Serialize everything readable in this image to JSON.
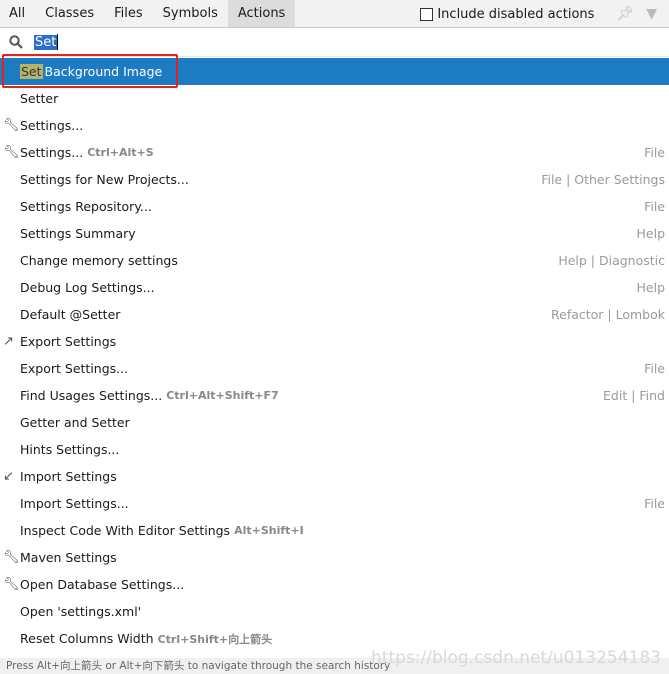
{
  "tabs": [
    "All",
    "Classes",
    "Files",
    "Symbols",
    "Actions"
  ],
  "active_tab": "Actions",
  "include_disabled_label": "Include disabled actions",
  "include_disabled_checked": false,
  "search": {
    "value": "Set"
  },
  "selected": {
    "highlight": "Set",
    "rest": "Background Image"
  },
  "items": [
    {
      "label": "Setter",
      "shortcut": "",
      "group": "",
      "icon": ""
    },
    {
      "label": "Settings...",
      "shortcut": "",
      "group": "",
      "icon": "wrench-icon"
    },
    {
      "label": "Settings...",
      "shortcut": "Ctrl+Alt+S",
      "group": "File",
      "icon": "wrench-icon"
    },
    {
      "label": "Settings for New Projects...",
      "shortcut": "",
      "group": "File | Other Settings",
      "icon": ""
    },
    {
      "label": "Settings Repository...",
      "shortcut": "",
      "group": "File",
      "icon": ""
    },
    {
      "label": "Settings Summary",
      "shortcut": "",
      "group": "Help",
      "icon": ""
    },
    {
      "label": "Change memory settings",
      "shortcut": "",
      "group": "Help | Diagnostic",
      "icon": ""
    },
    {
      "label": "Debug Log Settings...",
      "shortcut": "",
      "group": "Help",
      "icon": ""
    },
    {
      "label": "Default @Setter",
      "shortcut": "",
      "group": "Refactor | Lombok",
      "icon": ""
    },
    {
      "label": "Export Settings",
      "shortcut": "",
      "group": "",
      "icon": "export-icon"
    },
    {
      "label": "Export Settings...",
      "shortcut": "",
      "group": "File",
      "icon": ""
    },
    {
      "label": "Find Usages Settings...",
      "shortcut": "Ctrl+Alt+Shift+F7",
      "group": "Edit | Find",
      "icon": ""
    },
    {
      "label": "Getter and Setter",
      "shortcut": "",
      "group": "",
      "icon": ""
    },
    {
      "label": "Hints Settings...",
      "shortcut": "",
      "group": "",
      "icon": ""
    },
    {
      "label": "Import Settings",
      "shortcut": "",
      "group": "",
      "icon": "import-icon"
    },
    {
      "label": "Import Settings...",
      "shortcut": "",
      "group": "File",
      "icon": ""
    },
    {
      "label": "Inspect Code With Editor Settings",
      "shortcut": "Alt+Shift+I",
      "group": "",
      "icon": ""
    },
    {
      "label": "Maven Settings",
      "shortcut": "",
      "group": "",
      "icon": "wrench-icon"
    },
    {
      "label": "Open Database Settings...",
      "shortcut": "",
      "group": "",
      "icon": "wrench-icon"
    },
    {
      "label": "Open 'settings.xml'",
      "shortcut": "",
      "group": "",
      "icon": ""
    },
    {
      "label": "Reset Columns Width",
      "shortcut": "Ctrl+Shift+向上箭头",
      "group": "",
      "icon": ""
    }
  ],
  "footer": "Press Alt+向上箭头 or Alt+向下箭头 to navigate through the search history",
  "watermark": "https://blog.csdn.net/u013254183"
}
